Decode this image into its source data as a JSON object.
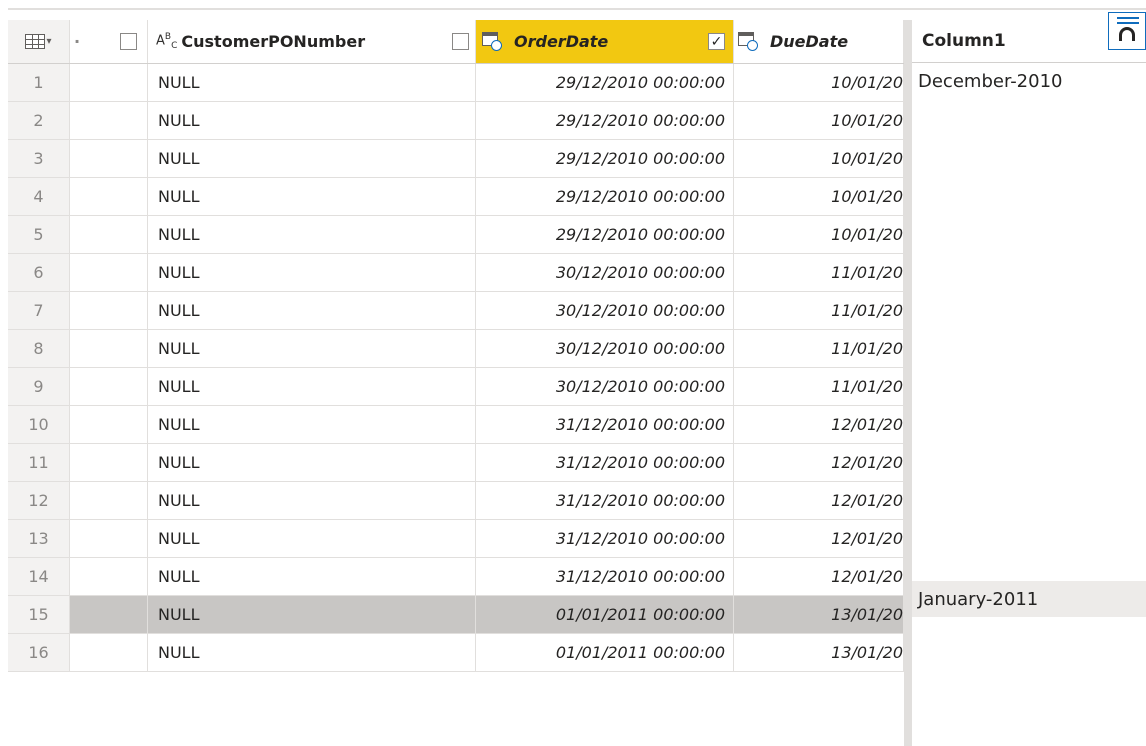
{
  "columns": {
    "c": "CustomerPONumber",
    "c_type": "ABC",
    "d": "OrderDate",
    "d_checked": "✓",
    "e": "DueDate"
  },
  "rows": [
    {
      "n": "1",
      "po": "NULL",
      "order": "29/12/2010 00:00:00",
      "due": "10/01/20"
    },
    {
      "n": "2",
      "po": "NULL",
      "order": "29/12/2010 00:00:00",
      "due": "10/01/20"
    },
    {
      "n": "3",
      "po": "NULL",
      "order": "29/12/2010 00:00:00",
      "due": "10/01/20"
    },
    {
      "n": "4",
      "po": "NULL",
      "order": "29/12/2010 00:00:00",
      "due": "10/01/20"
    },
    {
      "n": "5",
      "po": "NULL",
      "order": "29/12/2010 00:00:00",
      "due": "10/01/20"
    },
    {
      "n": "6",
      "po": "NULL",
      "order": "30/12/2010 00:00:00",
      "due": "11/01/20"
    },
    {
      "n": "7",
      "po": "NULL",
      "order": "30/12/2010 00:00:00",
      "due": "11/01/20"
    },
    {
      "n": "8",
      "po": "NULL",
      "order": "30/12/2010 00:00:00",
      "due": "11/01/20"
    },
    {
      "n": "9",
      "po": "NULL",
      "order": "30/12/2010 00:00:00",
      "due": "11/01/20"
    },
    {
      "n": "10",
      "po": "NULL",
      "order": "31/12/2010 00:00:00",
      "due": "12/01/20"
    },
    {
      "n": "11",
      "po": "NULL",
      "order": "31/12/2010 00:00:00",
      "due": "12/01/20"
    },
    {
      "n": "12",
      "po": "NULL",
      "order": "31/12/2010 00:00:00",
      "due": "12/01/20"
    },
    {
      "n": "13",
      "po": "NULL",
      "order": "31/12/2010 00:00:00",
      "due": "12/01/20"
    },
    {
      "n": "14",
      "po": "NULL",
      "order": "31/12/2010 00:00:00",
      "due": "12/01/20"
    },
    {
      "n": "15",
      "po": "NULL",
      "order": "01/01/2011 00:00:00",
      "due": "13/01/20"
    },
    {
      "n": "16",
      "po": "NULL",
      "order": "01/01/2011 00:00:00",
      "due": "13/01/20"
    }
  ],
  "highlighted_row": "15",
  "side_panel": {
    "header": "Column1",
    "values": [
      "December-2010",
      "",
      "",
      "",
      "",
      "",
      "",
      "",
      "",
      "",
      "",
      "",
      "",
      "",
      "January-2011",
      ""
    ],
    "highlighted_index": 14
  },
  "icons": {
    "table_menu": "table-icon",
    "datetime_type": "calendar-clock-icon",
    "step_tool": "step-icon"
  },
  "colors": {
    "selected_header": "#f2c811",
    "highlight_row": "#c8c6c4",
    "accent": "#0f6cbd"
  }
}
